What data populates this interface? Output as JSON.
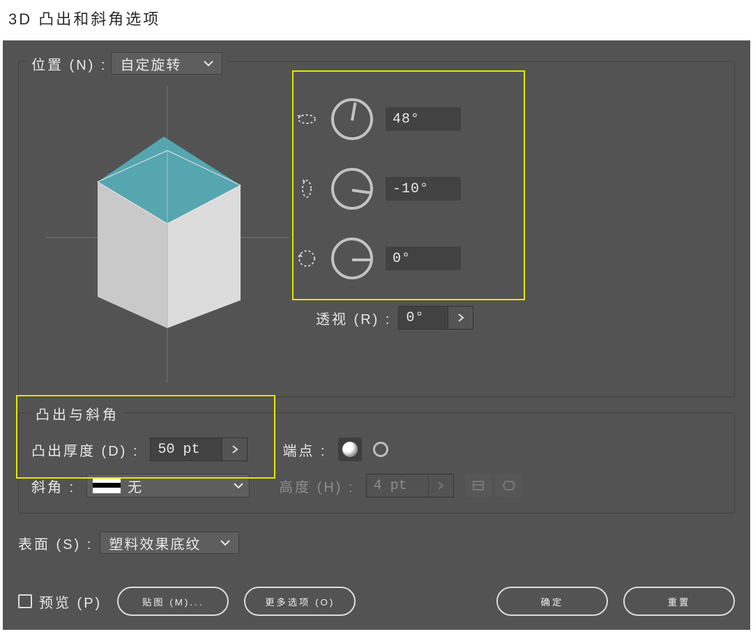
{
  "title": "3D 凸出和斜角选项",
  "position": {
    "label": "位置 (N) :",
    "select_value": "自定旋转",
    "rot_x": "48°",
    "rot_y": "-10°",
    "rot_z": "0°",
    "perspective_label": "透视 (R) :",
    "perspective_value": "0°"
  },
  "extrude": {
    "header": "凸出与斜角",
    "depth_label": "凸出厚度 (D) :",
    "depth_value": "50 pt",
    "cap_label": "端点 :",
    "bevel_label": "斜角 :",
    "bevel_value": "无",
    "height_label": "高度 (H) :",
    "height_value": "4 pt"
  },
  "surface": {
    "label": "表面 (S) :",
    "value": "塑料效果底纹"
  },
  "buttons": {
    "preview": "预览 (P)",
    "map_art": "贴图 (M)...",
    "more": "更多选项 (O)",
    "ok": "确定",
    "reset": "重置"
  }
}
